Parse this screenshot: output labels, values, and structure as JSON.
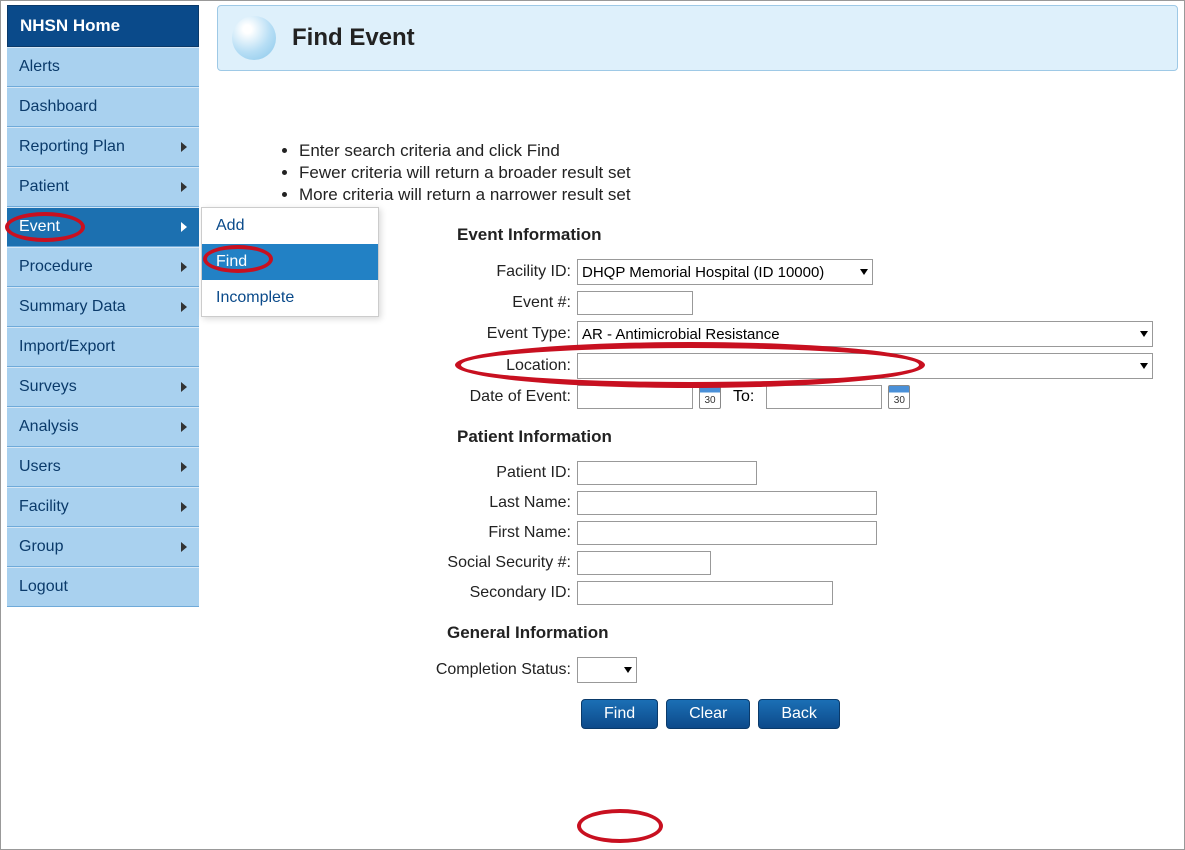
{
  "sidebar": {
    "home": "NHSN Home",
    "items": [
      {
        "label": "Alerts",
        "hasSubmenu": false
      },
      {
        "label": "Dashboard",
        "hasSubmenu": false
      },
      {
        "label": "Reporting Plan",
        "hasSubmenu": true
      },
      {
        "label": "Patient",
        "hasSubmenu": true
      },
      {
        "label": "Event",
        "hasSubmenu": true,
        "active": true
      },
      {
        "label": "Procedure",
        "hasSubmenu": true
      },
      {
        "label": "Summary Data",
        "hasSubmenu": true
      },
      {
        "label": "Import/Export",
        "hasSubmenu": false
      },
      {
        "label": "Surveys",
        "hasSubmenu": true
      },
      {
        "label": "Analysis",
        "hasSubmenu": true
      },
      {
        "label": "Users",
        "hasSubmenu": true
      },
      {
        "label": "Facility",
        "hasSubmenu": true
      },
      {
        "label": "Group",
        "hasSubmenu": true
      },
      {
        "label": "Logout",
        "hasSubmenu": false
      }
    ]
  },
  "submenu": {
    "items": [
      {
        "label": "Add"
      },
      {
        "label": "Find",
        "highlighted": true
      },
      {
        "label": "Incomplete"
      }
    ]
  },
  "header": {
    "title": "Find Event"
  },
  "instructions": [
    "Enter search criteria and click Find",
    "Fewer criteria will return a broader result set",
    "More criteria will return a narrower result set"
  ],
  "sections": {
    "event": "Event Information",
    "patient": "Patient Information",
    "general": "General Information"
  },
  "fields": {
    "facility_id": {
      "label": "Facility ID:",
      "value": "DHQP Memorial Hospital (ID 10000)"
    },
    "event_num": {
      "label": "Event #:",
      "value": ""
    },
    "event_type": {
      "label": "Event Type:",
      "value": "AR - Antimicrobial Resistance"
    },
    "location": {
      "label": "Location:",
      "value": ""
    },
    "date_of_event": {
      "label": "Date of Event:",
      "to": "To:",
      "from_val": "",
      "to_val": ""
    },
    "patient_id": {
      "label": "Patient ID:",
      "value": ""
    },
    "last_name": {
      "label": "Last Name:",
      "value": ""
    },
    "first_name": {
      "label": "First Name:",
      "value": ""
    },
    "ssn": {
      "label": "Social Security #:",
      "value": ""
    },
    "secondary_id": {
      "label": "Secondary ID:",
      "value": ""
    },
    "completion_status": {
      "label": "Completion Status:",
      "value": ""
    }
  },
  "buttons": {
    "find": "Find",
    "clear": "Clear",
    "back": "Back"
  },
  "cal_text": "30"
}
